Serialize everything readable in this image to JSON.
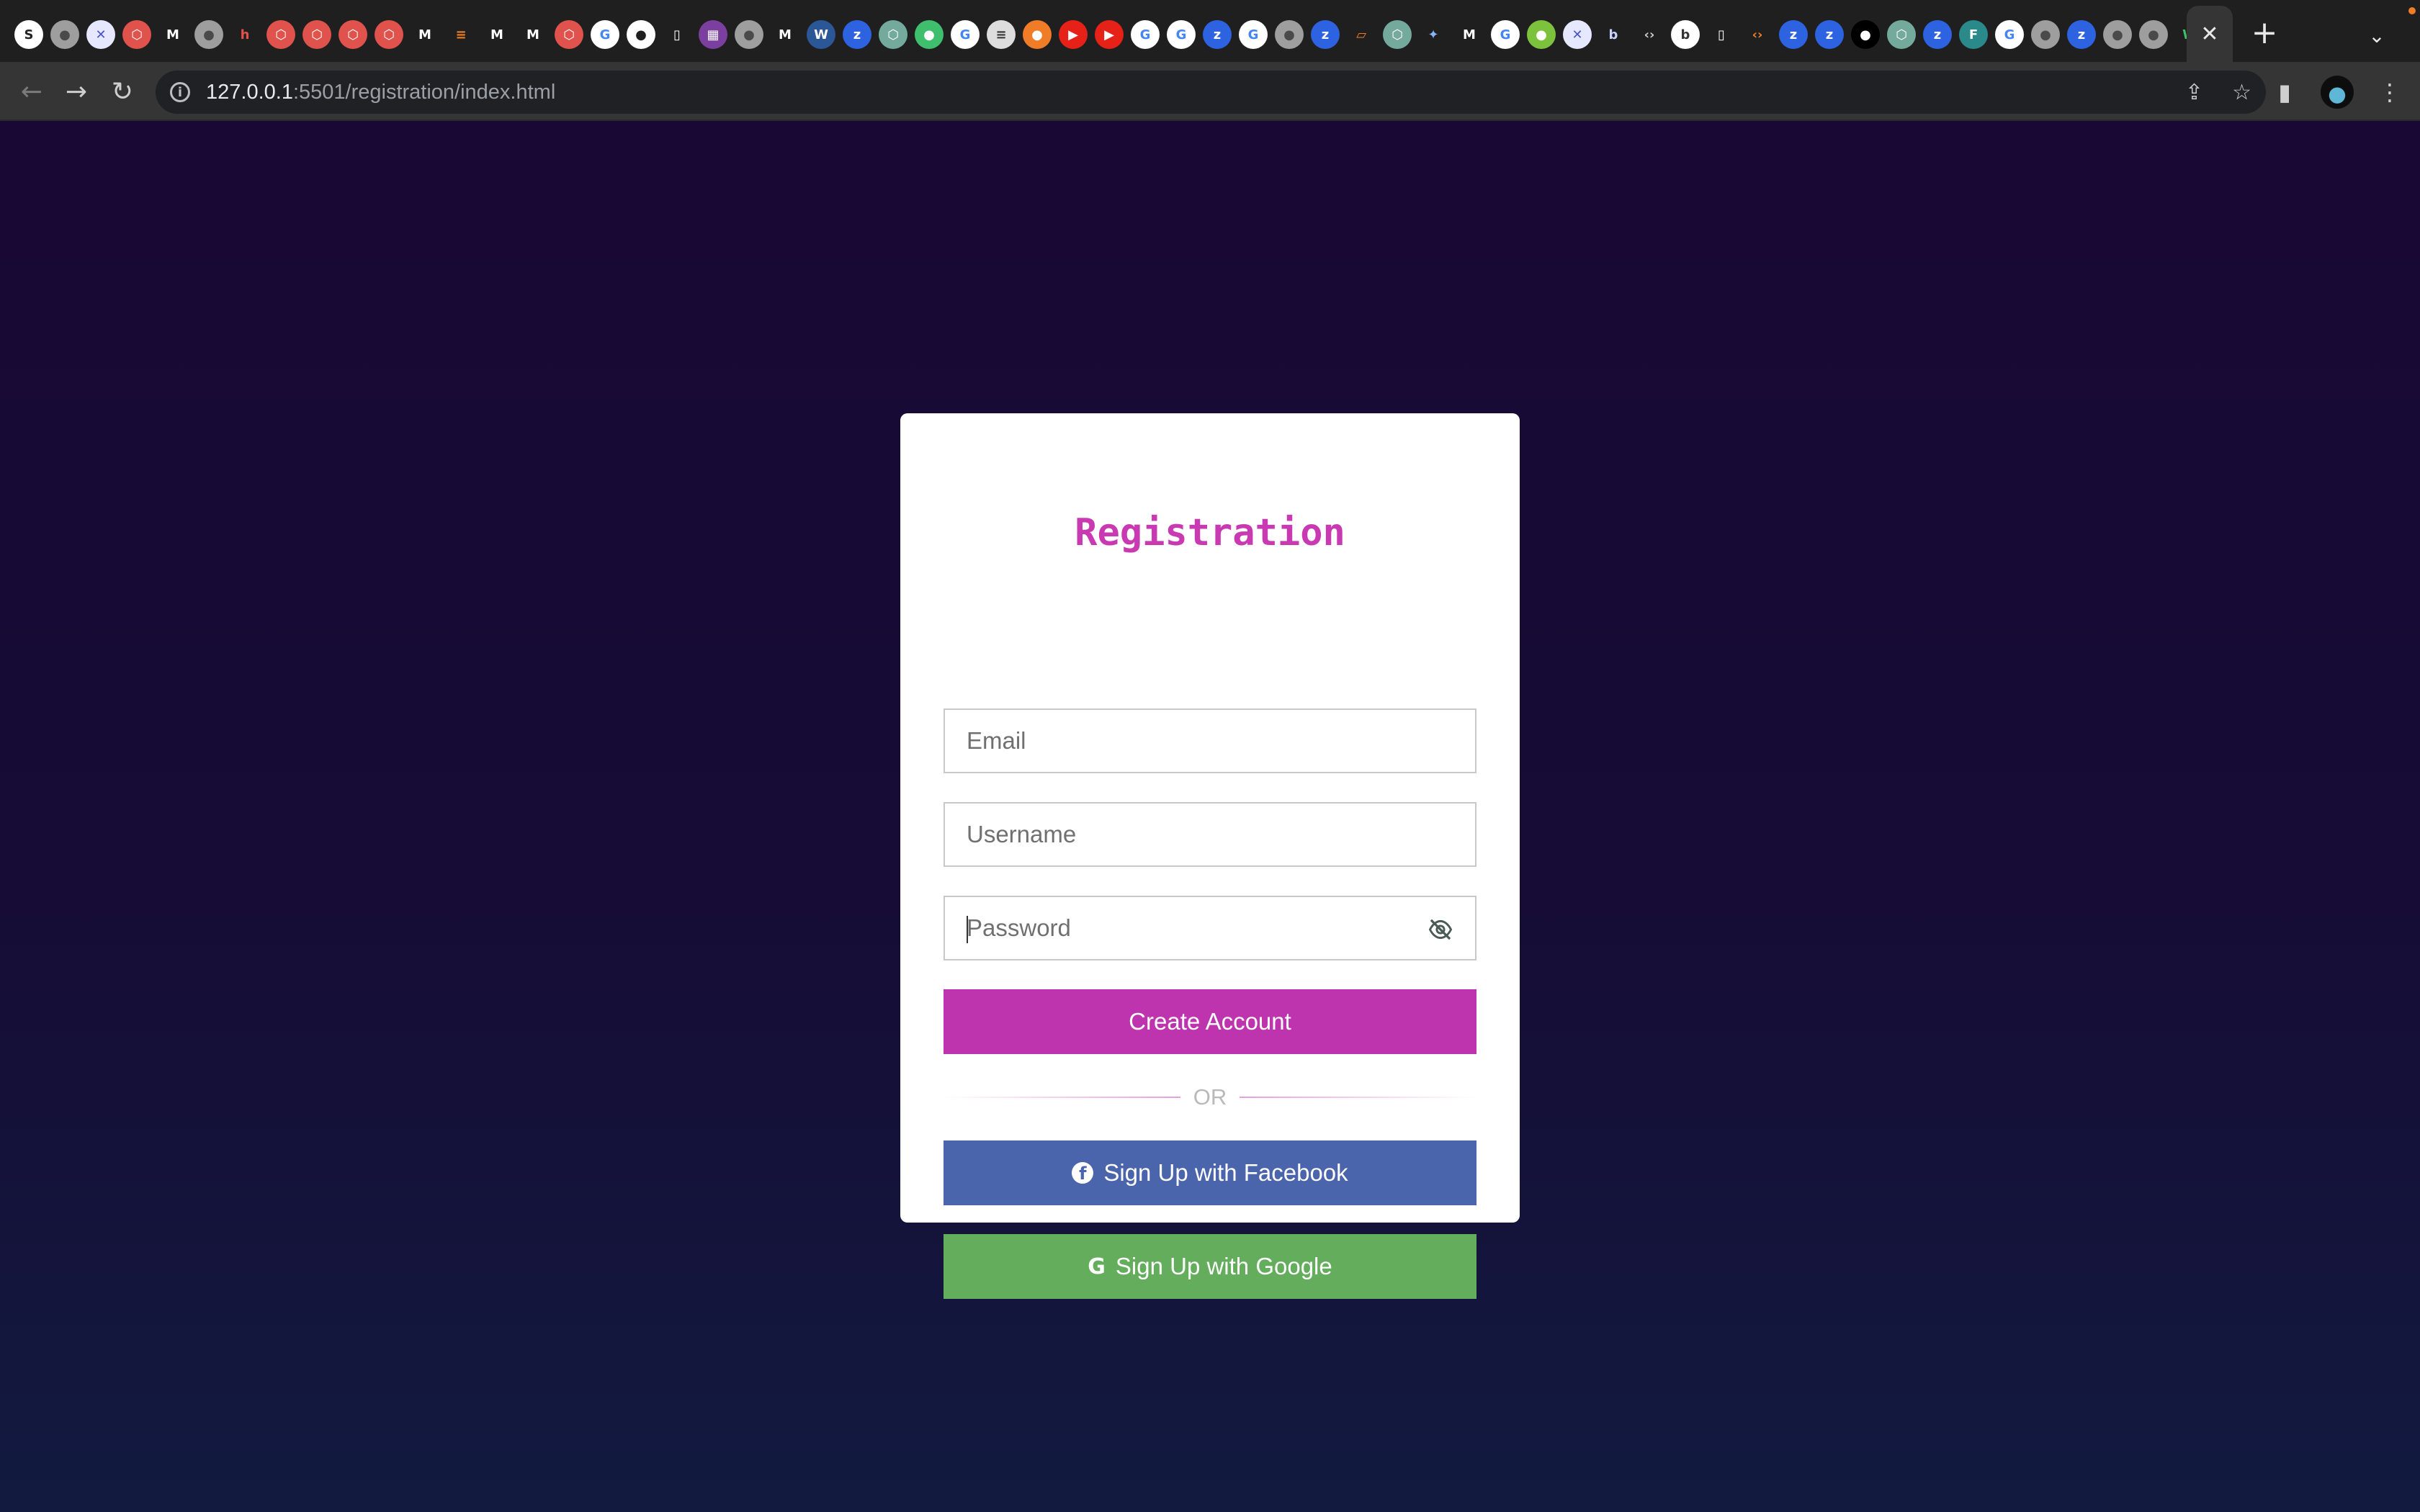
{
  "browser": {
    "favicons": [
      {
        "glyph": "S",
        "bg": "#ffffff",
        "fg": "#222222",
        "name": "sketch-favicon"
      },
      {
        "glyph": "●",
        "bg": "#9e9e9e",
        "fg": "#4a4a4a",
        "name": "globe-favicon"
      },
      {
        "glyph": "✕",
        "bg": "#e6e8ff",
        "fg": "#4a52c8",
        "name": "tools-favicon"
      },
      {
        "glyph": "⬡",
        "bg": "#e0524c",
        "fg": "#ffffff",
        "name": "openai-red-favicon"
      },
      {
        "glyph": "M",
        "bg": "#1f1f1f",
        "fg": "#ffffff",
        "name": "medium-favicon"
      },
      {
        "glyph": "●",
        "bg": "#9e9e9e",
        "fg": "#4a4a4a",
        "name": "globe-favicon"
      },
      {
        "glyph": "h",
        "bg": "#1f1f1f",
        "fg": "#e0524c",
        "name": "http-favicon"
      },
      {
        "glyph": "⬡",
        "bg": "#e0524c",
        "fg": "#ffffff",
        "name": "openai-red-favicon"
      },
      {
        "glyph": "⬡",
        "bg": "#e0524c",
        "fg": "#ffffff",
        "name": "openai-red-favicon"
      },
      {
        "glyph": "⬡",
        "bg": "#e0524c",
        "fg": "#ffffff",
        "name": "openai-red-favicon"
      },
      {
        "glyph": "⬡",
        "bg": "#e0524c",
        "fg": "#ffffff",
        "name": "openai-red-favicon"
      },
      {
        "glyph": "M",
        "bg": "#1f1f1f",
        "fg": "#ffffff",
        "name": "medium-favicon"
      },
      {
        "glyph": "≡",
        "bg": "#1f1f1f",
        "fg": "#f48024",
        "name": "stackoverflow-favicon"
      },
      {
        "glyph": "M",
        "bg": "#1f1f1f",
        "fg": "#ffffff",
        "name": "medium-favicon"
      },
      {
        "glyph": "M",
        "bg": "#1f1f1f",
        "fg": "#ffffff",
        "name": "medium-favicon"
      },
      {
        "glyph": "⬡",
        "bg": "#e0524c",
        "fg": "#ffffff",
        "name": "openai-red-favicon"
      },
      {
        "glyph": "G",
        "bg": "#ffffff",
        "fg": "#4285f4",
        "name": "google-favicon"
      },
      {
        "glyph": "●",
        "bg": "#ffffff",
        "fg": "#1f1f1f",
        "name": "github-favicon"
      },
      {
        "glyph": "▯",
        "bg": "#1f1f1f",
        "fg": "#ffffff",
        "name": "doc-favicon"
      },
      {
        "glyph": "▦",
        "bg": "#7b3fa0",
        "fg": "#ffffff",
        "name": "image-favicon"
      },
      {
        "glyph": "●",
        "bg": "#9e9e9e",
        "fg": "#4a4a4a",
        "name": "globe-favicon"
      },
      {
        "glyph": "M",
        "bg": "#1f1f1f",
        "fg": "#ffffff",
        "name": "medium-favicon"
      },
      {
        "glyph": "W",
        "bg": "#2b5797",
        "fg": "#ffffff",
        "name": "word-favicon"
      },
      {
        "glyph": "z",
        "bg": "#2d63e0",
        "fg": "#ffffff",
        "name": "zoom-favicon"
      },
      {
        "glyph": "⬡",
        "bg": "#74aa9c",
        "fg": "#ffffff",
        "name": "chatgpt-favicon"
      },
      {
        "glyph": "●",
        "bg": "#3fbf6e",
        "fg": "#ffffff",
        "name": "green-favicon"
      },
      {
        "glyph": "G",
        "bg": "#ffffff",
        "fg": "#4285f4",
        "name": "google-favicon"
      },
      {
        "glyph": "≡",
        "bg": "#dddddd",
        "fg": "#333333",
        "name": "db-favicon"
      },
      {
        "glyph": "●",
        "bg": "#f07c28",
        "fg": "#ffffff",
        "name": "duckduckgo-favicon"
      },
      {
        "glyph": "▶",
        "bg": "#e62117",
        "fg": "#ffffff",
        "name": "youtube-favicon"
      },
      {
        "glyph": "▶",
        "bg": "#e62117",
        "fg": "#ffffff",
        "name": "youtube-favicon"
      },
      {
        "glyph": "G",
        "bg": "#ffffff",
        "fg": "#4285f4",
        "name": "google-favicon"
      },
      {
        "glyph": "G",
        "bg": "#ffffff",
        "fg": "#4285f4",
        "name": "google-favicon"
      },
      {
        "glyph": "z",
        "bg": "#2d63e0",
        "fg": "#ffffff",
        "name": "zoom-favicon"
      },
      {
        "glyph": "G",
        "bg": "#ffffff",
        "fg": "#4285f4",
        "name": "google-favicon"
      },
      {
        "glyph": "●",
        "bg": "#9e9e9e",
        "fg": "#4a4a4a",
        "name": "globe-favicon"
      },
      {
        "glyph": "z",
        "bg": "#2d63e0",
        "fg": "#ffffff",
        "name": "zoom-favicon"
      },
      {
        "glyph": "▱",
        "bg": "#1f1f1f",
        "fg": "#f07c28",
        "name": "orange-favicon"
      },
      {
        "glyph": "⬡",
        "bg": "#74aa9c",
        "fg": "#ffffff",
        "name": "chatgpt-favicon"
      },
      {
        "glyph": "✦",
        "bg": "#1f1f1f",
        "fg": "#8ab4f8",
        "name": "gemini-favicon"
      },
      {
        "glyph": "M",
        "bg": "#1f1f1f",
        "fg": "#ffffff",
        "name": "medium-favicon"
      },
      {
        "glyph": "G",
        "bg": "#ffffff",
        "fg": "#4285f4",
        "name": "google-favicon"
      },
      {
        "glyph": "●",
        "bg": "#7cc23c",
        "fg": "#ffffff",
        "name": "android-favicon"
      },
      {
        "glyph": "✕",
        "bg": "#e6e8ff",
        "fg": "#4a52c8",
        "name": "tools-favicon"
      },
      {
        "glyph": "b",
        "bg": "#1f1f1f",
        "fg": "#c9d3ff",
        "name": "b-favicon"
      },
      {
        "glyph": "‹›",
        "bg": "#1f1f1f",
        "fg": "#cccccc",
        "name": "code-favicon"
      },
      {
        "glyph": "b",
        "bg": "#ffffff",
        "fg": "#333333",
        "name": "b-favicon"
      },
      {
        "glyph": "▯",
        "bg": "#1f1f1f",
        "fg": "#ffffff",
        "name": "doc-favicon"
      },
      {
        "glyph": "‹›",
        "bg": "#1f1f1f",
        "fg": "#f07c28",
        "name": "code-favicon"
      },
      {
        "glyph": "z",
        "bg": "#2d63e0",
        "fg": "#ffffff",
        "name": "zoom-favicon"
      },
      {
        "glyph": "z",
        "bg": "#2d63e0",
        "fg": "#ffffff",
        "name": "zoom-favicon"
      },
      {
        "glyph": "●",
        "bg": "#000000",
        "fg": "#ffffff",
        "name": "medium-dots-favicon"
      },
      {
        "glyph": "⬡",
        "bg": "#74aa9c",
        "fg": "#ffffff",
        "name": "chatgpt-favicon"
      },
      {
        "glyph": "z",
        "bg": "#2d63e0",
        "fg": "#ffffff",
        "name": "zoom-favicon"
      },
      {
        "glyph": "F",
        "bg": "#2a8a8a",
        "fg": "#ffffff",
        "name": "f-favicon"
      },
      {
        "glyph": "G",
        "bg": "#ffffff",
        "fg": "#4285f4",
        "name": "google-favicon"
      },
      {
        "glyph": "●",
        "bg": "#9e9e9e",
        "fg": "#4a4a4a",
        "name": "globe-favicon"
      },
      {
        "glyph": "z",
        "bg": "#2d63e0",
        "fg": "#ffffff",
        "name": "zoom-favicon"
      },
      {
        "glyph": "●",
        "bg": "#9e9e9e",
        "fg": "#4a4a4a",
        "name": "globe-favicon"
      },
      {
        "glyph": "●",
        "bg": "#9e9e9e",
        "fg": "#4a4a4a",
        "name": "globe-favicon"
      },
      {
        "glyph": "W",
        "bg": "#1f1f1f",
        "fg": "#3fbf6e",
        "name": "w-favicon"
      }
    ],
    "active_tab_close": "✕",
    "new_tab": "+",
    "tab_search": "⌄",
    "back": "←",
    "forward": "→",
    "reload": "↻",
    "site_info": "i",
    "url_host": "127.0.0.1",
    "url_rest": ":5501/registration/index.html",
    "share_icon": "⇪",
    "bookmark_icon": "☆",
    "sidepanel_icon": "▮",
    "menu_icon": "⋮"
  },
  "form": {
    "title": "Registration",
    "email_placeholder": "Email",
    "username_placeholder": "Username",
    "password_placeholder": "Password",
    "create_button": "Create Account",
    "or_text": "OR",
    "facebook_button": "Sign Up with Facebook",
    "google_button": "Sign Up with Google",
    "facebook_glyph": "f",
    "google_glyph": "G"
  },
  "colors": {
    "accent": "#c93ab2",
    "create_button": "#bd34ae",
    "facebook": "#4a65ac",
    "google": "#63ad5c",
    "page_bg": "#180833"
  }
}
